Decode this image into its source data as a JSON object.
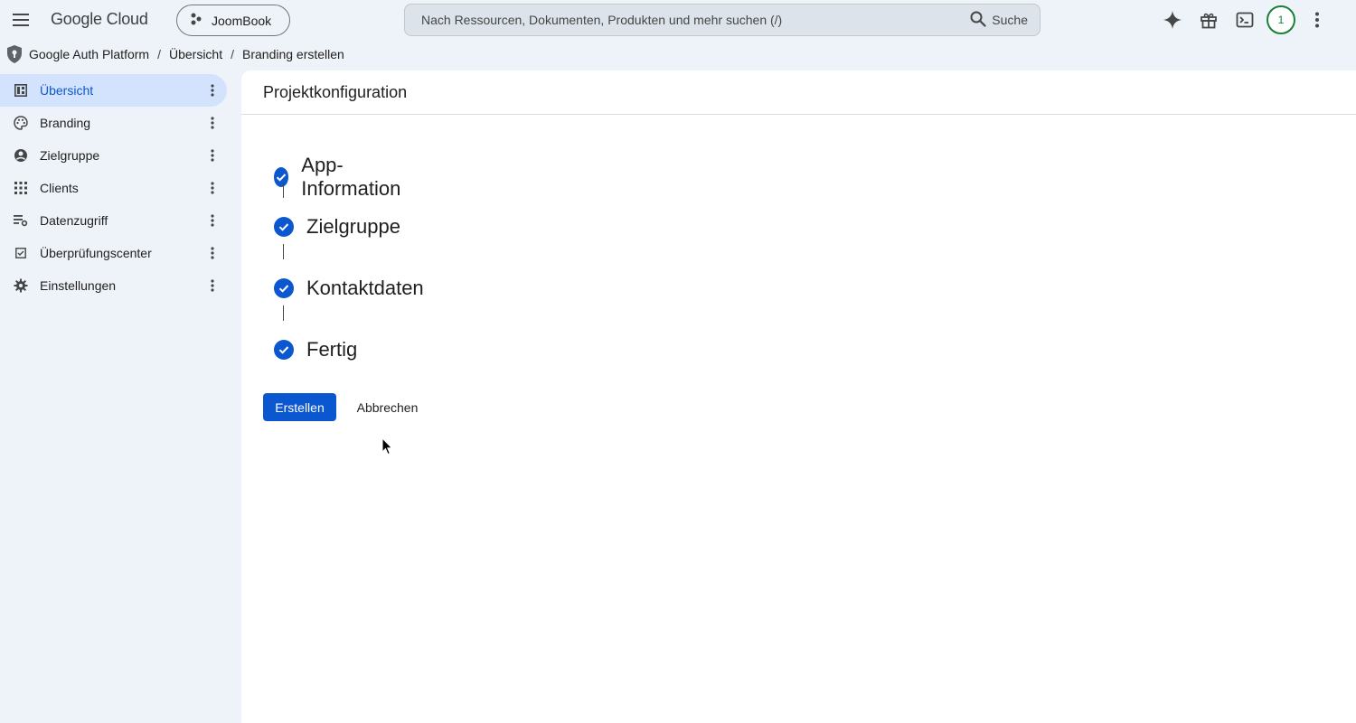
{
  "topbar": {
    "logo": "Google Cloud",
    "project_name": "JoomBook",
    "search_placeholder": "Nach Ressourcen, Dokumenten, Produkten und mehr suchen (/)",
    "search_button": "Suche",
    "avatar_count": "1",
    "icons": [
      "hamburger-menu-icon",
      "gemini-spark-icon",
      "gift-icon",
      "cloud-shell-icon",
      "more-vert-icon"
    ]
  },
  "breadcrumb": {
    "items": [
      "Google Auth Platform",
      "Übersicht",
      "Branding erstellen"
    ],
    "separator": "/"
  },
  "sidebar": {
    "items": [
      {
        "label": "Übersicht",
        "icon": "dashboard-icon",
        "active": true
      },
      {
        "label": "Branding",
        "icon": "palette-icon"
      },
      {
        "label": "Zielgruppe",
        "icon": "account-circle-icon"
      },
      {
        "label": "Clients",
        "icon": "apps-grid-icon"
      },
      {
        "label": "Datenzugriff",
        "icon": "data-access-icon"
      },
      {
        "label": "Überprüfungscenter",
        "icon": "checkbox-icon"
      },
      {
        "label": "Einstellungen",
        "icon": "gear-icon"
      }
    ]
  },
  "main": {
    "header": "Projektkonfiguration",
    "steps": [
      {
        "label": "App-Information",
        "done": true
      },
      {
        "label": "Zielgruppe",
        "done": true
      },
      {
        "label": "Kontaktdaten",
        "done": true
      },
      {
        "label": "Fertig",
        "done": true
      }
    ],
    "primary_button": "Erstellen",
    "cancel_button": "Abbrechen"
  },
  "colors": {
    "accent": "#0b57d0",
    "background": "#eef2f9",
    "active_nav": "#d3e3fd",
    "avatar": "#188038"
  }
}
